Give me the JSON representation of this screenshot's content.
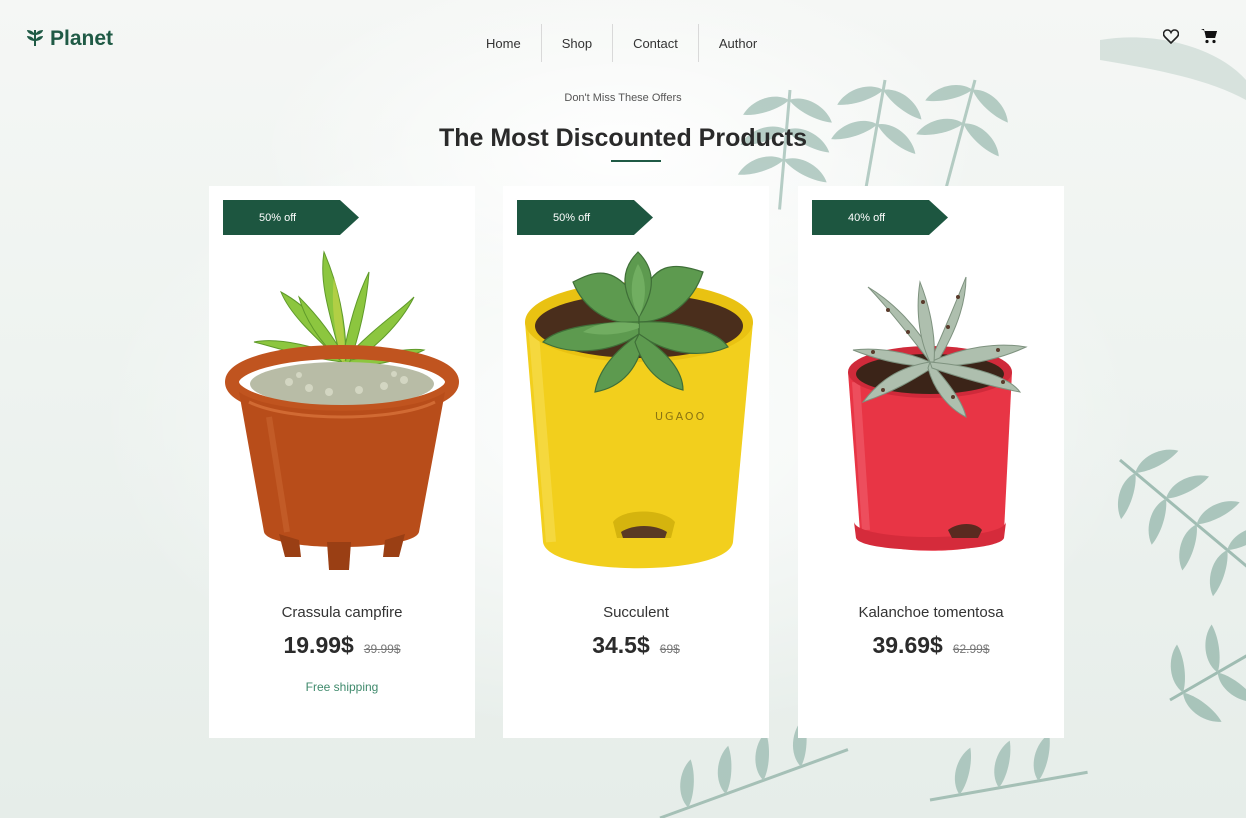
{
  "header": {
    "brand": "Planet",
    "nav": [
      "Home",
      "Shop",
      "Contact",
      "Author"
    ],
    "icons": [
      "heart-icon",
      "cart-icon"
    ]
  },
  "section": {
    "kicker": "Don't Miss These Offers",
    "title": "The Most Discounted Products"
  },
  "products": [
    {
      "badge": "50% off",
      "name": "Crassula campfire",
      "price": "19.99$",
      "old_price": "39.99$",
      "shipping": "Free shipping",
      "pot_color": "#c0541f"
    },
    {
      "badge": "50% off",
      "name": "Succulent",
      "price": "34.5$",
      "old_price": "69$",
      "pot_color": "#f2cf1d",
      "pot_text": "UGAOO"
    },
    {
      "badge": "40% off",
      "name": "Kalanchoe tomentosa",
      "price": "39.69$",
      "old_price": "62.99$",
      "pot_color": "#e83545"
    }
  ],
  "colors": {
    "brand": "#1f5a45",
    "badge": "#1d5640",
    "shipping": "#3f8a6c"
  }
}
